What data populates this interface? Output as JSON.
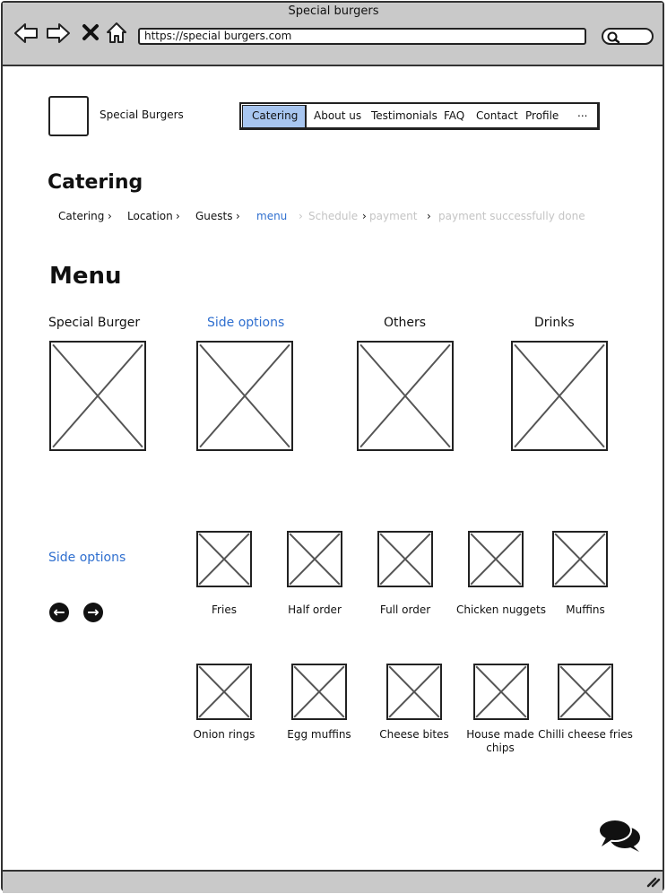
{
  "browser": {
    "title": "Special burgers",
    "url": "https://special burgers.com"
  },
  "header": {
    "brand": "Special Burgers",
    "nav": [
      "Catering",
      "About us",
      "Testimonials",
      "FAQ",
      "Contact",
      "Profile",
      "..."
    ]
  },
  "page": {
    "title": "Catering",
    "breadcrumbs": [
      "Catering",
      "Location",
      "Guests",
      "menu",
      "Schedule",
      "payment",
      "payment successfully done"
    ],
    "breadcrumb_active": "menu"
  },
  "menu": {
    "title": "Menu",
    "categories": [
      "Special Burger",
      "Side options",
      "Others",
      "Drinks"
    ],
    "selected_category": "Side options"
  },
  "side_options": {
    "title": "Side options",
    "row1": [
      "Fries",
      "Half order",
      "Full order",
      "Chicken nuggets",
      "Muffins"
    ],
    "row2": [
      "Onion rings",
      "Egg muffins",
      "Cheese bites",
      "House made chips",
      "Chilli cheese fries"
    ]
  },
  "colors": {
    "accent": "#2f6fcf",
    "nav_active": "#a8c6f0",
    "chrome": "#c9c9c9",
    "disabled": "#c4c4c4"
  },
  "icons": [
    "back-icon",
    "forward-icon",
    "close-icon",
    "home-icon",
    "search-icon",
    "prev-icon",
    "next-icon",
    "chat-icon",
    "resize-grip-icon"
  ]
}
